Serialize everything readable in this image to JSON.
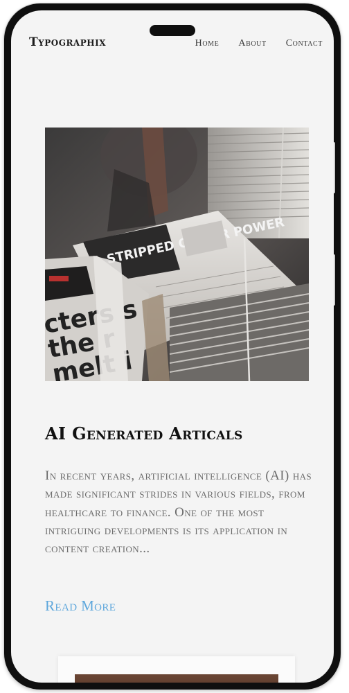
{
  "brand": "Typographix",
  "nav": {
    "home": "Home",
    "about": "About",
    "contact": "Contact"
  },
  "hero": {
    "alt": "Stacks of newspapers tied with string",
    "headline_image_text": "STRIPPED OF HER POWER",
    "side_image_text": "cters s the r melt i"
  },
  "article": {
    "title": "AI Generated Articals",
    "excerpt": "In recent years, artificial intelligence (AI) has made significant strides in various fields, from healthcare to finance. One of the most intriguing developments is its application in content creation...",
    "read_more": "Read More"
  },
  "colors": {
    "accent": "#5ea7dc",
    "title": "#111111",
    "body_text": "#6c6c6c",
    "background": "#f4f4f4"
  }
}
